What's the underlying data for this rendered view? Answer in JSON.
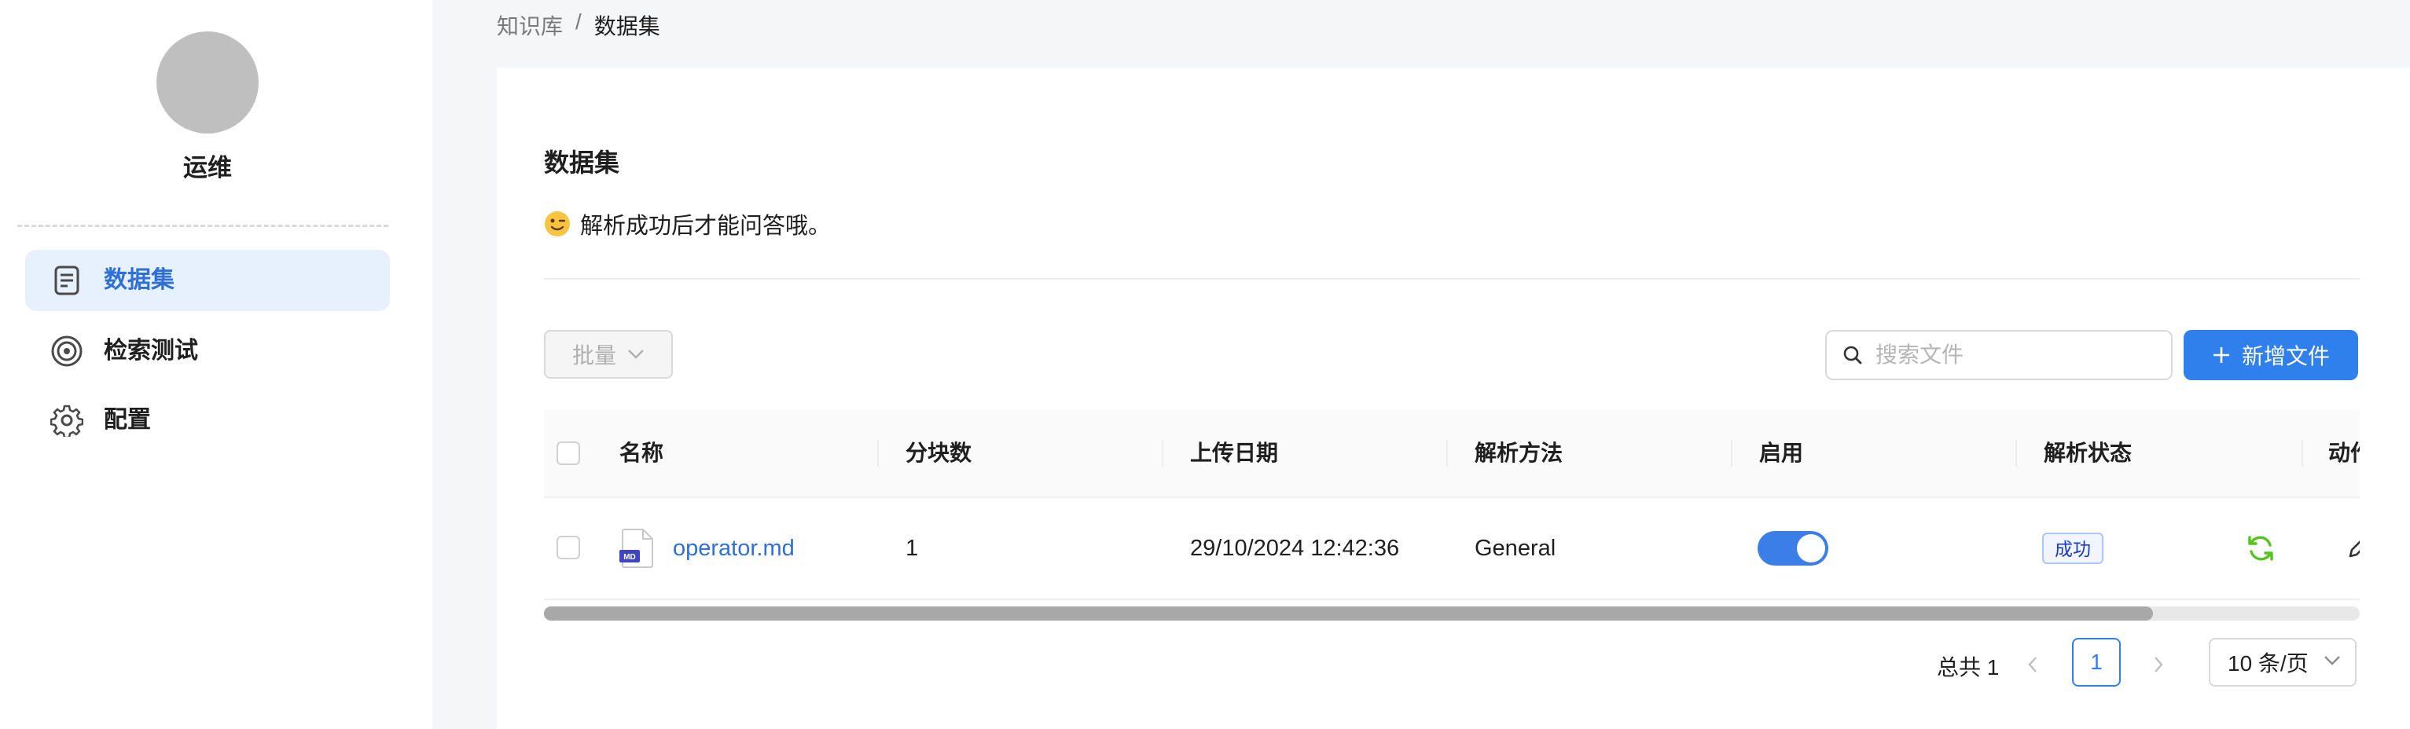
{
  "sidebar": {
    "kb_name": "运维",
    "items": [
      {
        "label": "数据集",
        "icon": "document-icon",
        "active": true
      },
      {
        "label": "检索测试",
        "icon": "target-icon",
        "active": false
      },
      {
        "label": "配置",
        "icon": "gear-icon",
        "active": false
      }
    ]
  },
  "breadcrumb": {
    "parent": "知识库",
    "separator": "/",
    "current": "数据集"
  },
  "main": {
    "title": "数据集",
    "hint_text": "解析成功后才能问答哦。",
    "hint_icon": "wink-emoji-icon",
    "batch_label": "批量",
    "search_placeholder": "搜索文件",
    "add_label": "新增文件"
  },
  "table": {
    "columns": [
      "名称",
      "分块数",
      "上传日期",
      "解析方法",
      "启用",
      "解析状态",
      "动作"
    ],
    "rows": [
      {
        "name": "operator.md",
        "file_icon": "md-file-icon",
        "chunks": "1",
        "upload_date": "29/10/2024 12:42:36",
        "parse_method": "General",
        "enabled": true,
        "status": "成功",
        "actions": [
          "refresh-icon",
          "edit-icon"
        ]
      }
    ],
    "scroll_fraction": 0.886
  },
  "pagination": {
    "total": "总共 1",
    "current_page": "1",
    "page_size": "10 条/页"
  },
  "colors": {
    "accent": "#2f80ed",
    "active_bg": "#e6f1fd",
    "active_text": "#2f6fd8",
    "success": "#52c41a"
  }
}
